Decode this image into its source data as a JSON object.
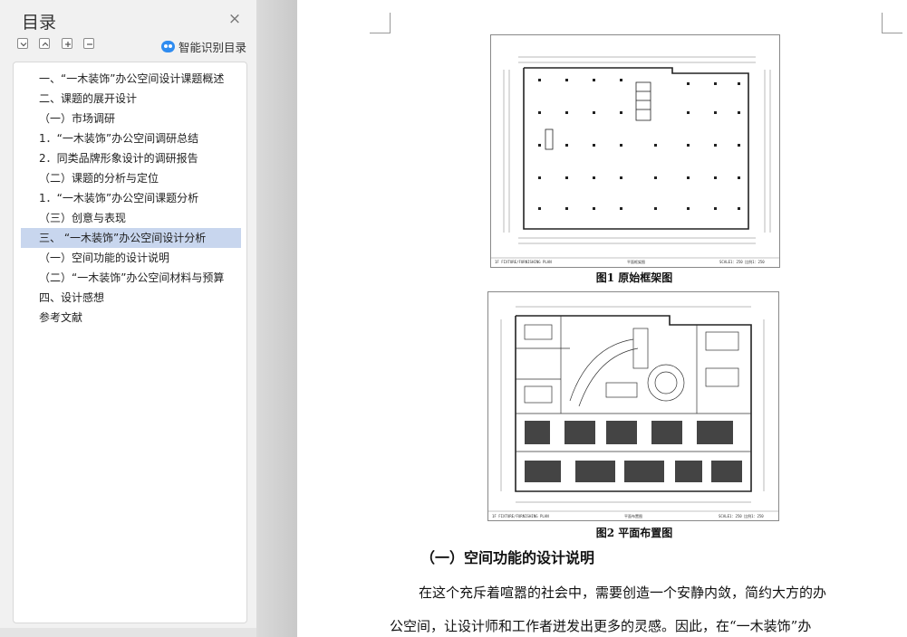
{
  "sidebar": {
    "title": "目录",
    "smart_label": "智能识别目录",
    "toc": [
      {
        "label": "一、“一木装饰”办公空间设计课题概述"
      },
      {
        "label": "二、课题的展开设计"
      },
      {
        "label": "（一）市场调研"
      },
      {
        "label": "1．“一木装饰”办公空间调研总结"
      },
      {
        "label": "2．同类品牌形象设计的调研报告"
      },
      {
        "label": "（二）课题的分析与定位"
      },
      {
        "label": "1．“一木装饰”办公空间课题分析"
      },
      {
        "label": "（三）创意与表现"
      },
      {
        "label": "三、 “一木装饰”办公空间设计分析"
      },
      {
        "label": "（一）空间功能的设计说明"
      },
      {
        "label": "（二）“一木装饰”办公空间材料与预算"
      },
      {
        "label": "四、设计感想"
      },
      {
        "label": "参考文献"
      }
    ],
    "active_index": 8
  },
  "document": {
    "figure1": {
      "caption": "图1  原始框架图",
      "titleblock_left": "1F FIXTURE/FURNISHING PLAN",
      "titleblock_mid": "平面框架图",
      "titleblock_right": "SCALE1：250 比例1：250"
    },
    "figure2": {
      "caption": "图2  平面布置图",
      "titleblock_left": "1F FIXTURE/FURNISHING PLAN",
      "titleblock_mid": "平面布置图",
      "titleblock_right": "SCALE1：250 比例1：250"
    },
    "heading": "（一）空间功能的设计说明",
    "para_line1": "在这个充斥着喧嚣的社会中，需要创造一个安静内敛，简约大方的办",
    "para_line2": "公空间，让设计师和工作者迸发出更多的灵感。因此，在“一木装饰”办"
  }
}
